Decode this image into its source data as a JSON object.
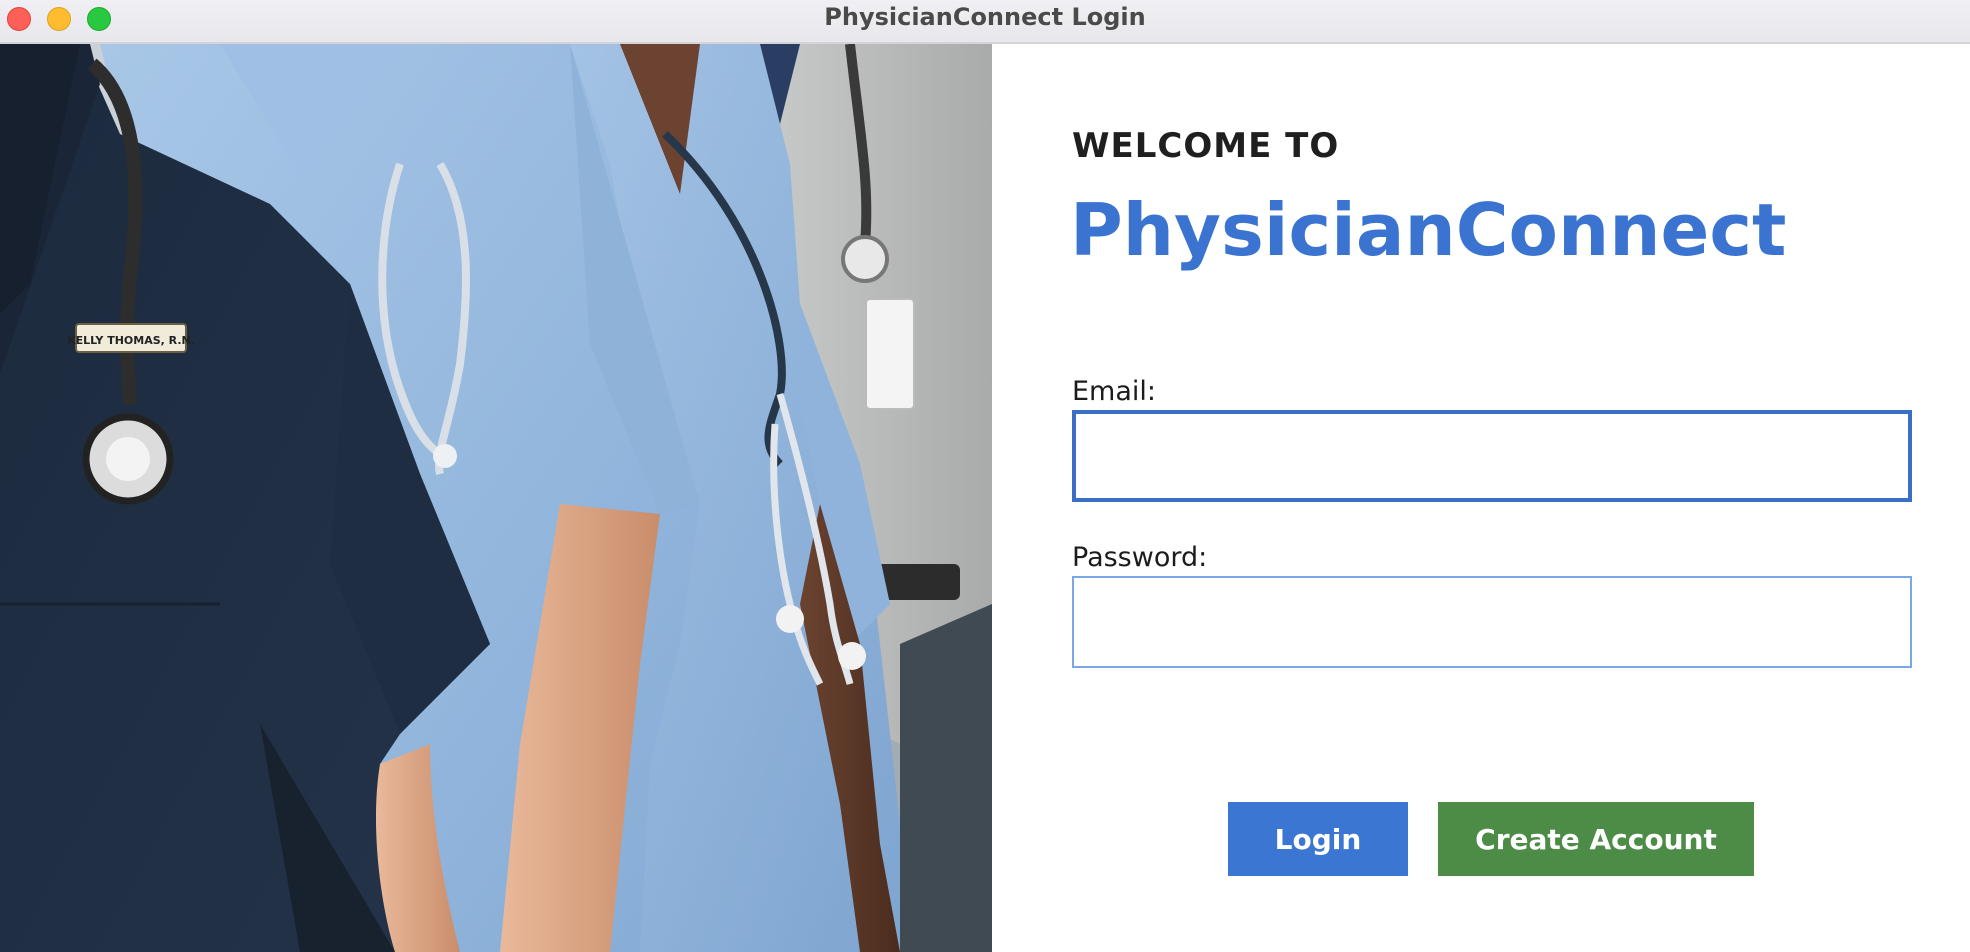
{
  "window": {
    "title": "PhysicianConnect Login"
  },
  "hero_image": {
    "description_icon": "medical-staff-photo",
    "name_badge_text": "KELLY THOMAS, R.N."
  },
  "form": {
    "welcome_text": "WELCOME TO",
    "brand_name": "PhysicianConnect",
    "email": {
      "label": "Email:",
      "value": "",
      "placeholder": ""
    },
    "password": {
      "label": "Password:",
      "value": "",
      "placeholder": ""
    },
    "login_label": "Login",
    "create_account_label": "Create Account"
  },
  "colors": {
    "brand": "#3a74d0",
    "login_button": "#3b76d3",
    "create_account_button": "#4d8c47",
    "focused_border": "#3a6fc4"
  }
}
